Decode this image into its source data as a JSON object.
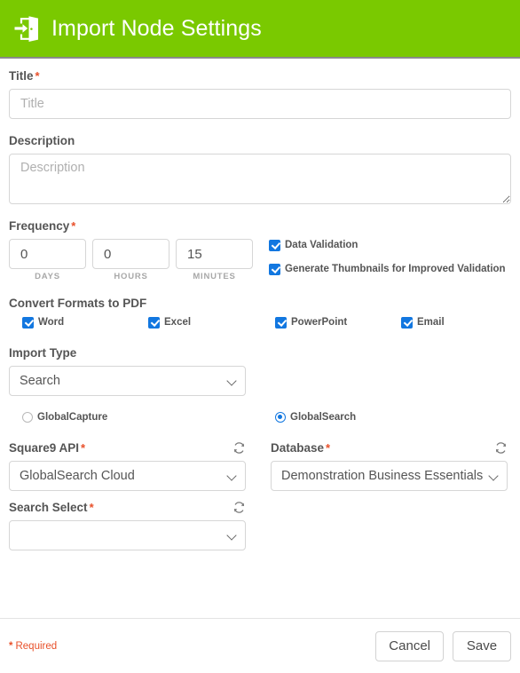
{
  "header": {
    "title": "Import Node Settings",
    "icon": "import-door-icon",
    "background_color": "#7ac900"
  },
  "form": {
    "title_field": {
      "label": "Title",
      "required": true,
      "value": "",
      "placeholder": "Title"
    },
    "description_field": {
      "label": "Description",
      "required": false,
      "value": "",
      "placeholder": "Description"
    },
    "frequency": {
      "label": "Frequency",
      "required": true,
      "units": [
        {
          "value": "0",
          "unit": "DAYS"
        },
        {
          "value": "0",
          "unit": "HOURS"
        },
        {
          "value": "15",
          "unit": "MINUTES"
        }
      ]
    },
    "validation_options": [
      {
        "label": "Data Validation",
        "checked": true
      },
      {
        "label": "Generate Thumbnails for Improved Validation",
        "checked": true
      }
    ],
    "convert_formats": {
      "label": "Convert Formats to PDF",
      "options": [
        {
          "label": "Word",
          "checked": true
        },
        {
          "label": "Excel",
          "checked": true
        },
        {
          "label": "PowerPoint",
          "checked": true
        },
        {
          "label": "Email",
          "checked": true
        }
      ]
    },
    "import_type": {
      "label": "Import Type",
      "required": false,
      "value": "Search"
    },
    "source_radios": [
      {
        "label": "GlobalCapture",
        "selected": false
      },
      {
        "label": "GlobalSearch",
        "selected": true
      }
    ],
    "square9_api": {
      "label": "Square9 API",
      "required": true,
      "value": "GlobalSearch Cloud",
      "refresh_icon": "refresh-icon"
    },
    "database": {
      "label": "Database",
      "required": true,
      "value": "Demonstration Business Essentials",
      "refresh_icon": "refresh-icon"
    },
    "search_select": {
      "label": "Search Select",
      "required": true,
      "value": "",
      "refresh_icon": "refresh-icon"
    }
  },
  "footer": {
    "required_star": "*",
    "required_text": "Required",
    "cancel_label": "Cancel",
    "save_label": "Save"
  },
  "colors": {
    "accent_green": "#7ac900",
    "checkbox_blue": "#1277e0",
    "required_red": "#e8502a"
  }
}
